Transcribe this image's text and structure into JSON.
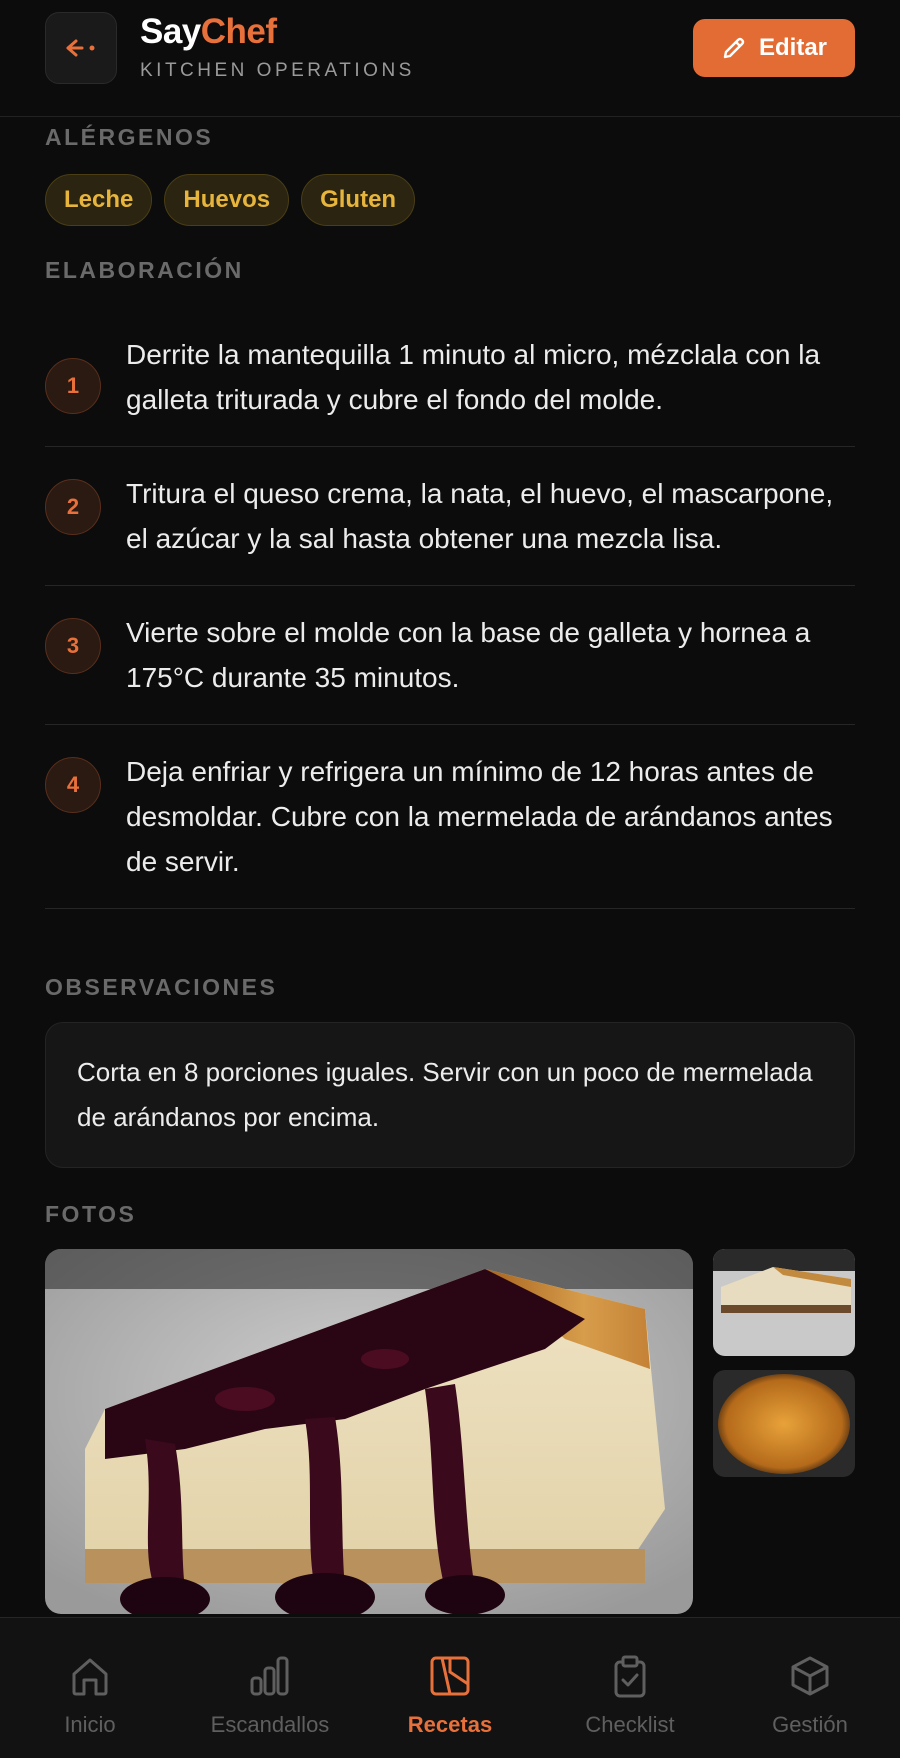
{
  "header": {
    "brand_say": "Say",
    "brand_chef": "Chef",
    "subtitle": "KITCHEN OPERATIONS",
    "edit_label": "Editar",
    "accent": "#e36c35"
  },
  "allergens": {
    "label": "ALÉRGENOS",
    "items": [
      "Leche",
      "Huevos",
      "Gluten"
    ]
  },
  "steps": {
    "label": "ELABORACIÓN",
    "items": [
      {
        "num": "1",
        "text": "Derrite la mantequilla 1 minuto al micro, mézclala con la galleta triturada y cubre el fondo del molde."
      },
      {
        "num": "2",
        "text": "Tritura el queso crema, la nata, el huevo, el mascarpone, el azúcar y la sal hasta obtener una mezcla lisa."
      },
      {
        "num": "3",
        "text": "Vierte sobre el molde con la base de galleta y hornea a 175°C durante 35 minutos."
      },
      {
        "num": "4",
        "text": "Deja enfriar y refrigera un mínimo de 12 horas antes de desmoldar. Cubre con la mermelada de arándanos antes de servir."
      }
    ]
  },
  "observations": {
    "label": "OBSERVACIONES",
    "text": "Corta en 8 porciones iguales. Servir con un poco de mermelada de arándanos por encima."
  },
  "photos": {
    "label": "FOTOS"
  },
  "nav": {
    "items": [
      {
        "label": "Inicio",
        "icon": "home-icon"
      },
      {
        "label": "Escandallos",
        "icon": "bar-chart-icon"
      },
      {
        "label": "Recetas",
        "icon": "recipe-book-icon",
        "active": true
      },
      {
        "label": "Checklist",
        "icon": "clipboard-check-icon"
      },
      {
        "label": "Gestión",
        "icon": "box-icon"
      }
    ]
  }
}
